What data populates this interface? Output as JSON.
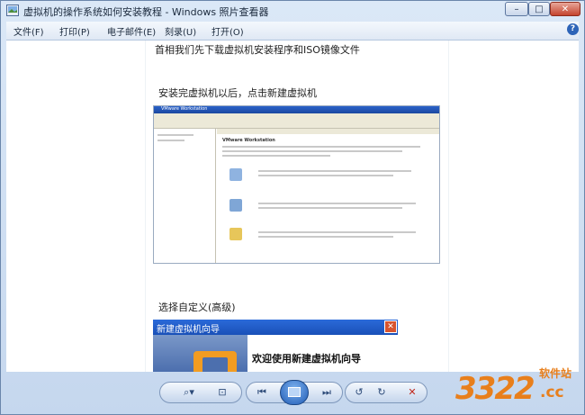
{
  "window": {
    "title": "虚拟机的操作系统如何安装教程 - Windows 照片查看器",
    "controls": {
      "minimize": "–",
      "maximize": "□",
      "close": "✕"
    }
  },
  "menubar": {
    "items": [
      "文件(F)",
      "打印(P)",
      "电子邮件(E)",
      "刻录(U)",
      "打开(O)"
    ],
    "help_glyph": "?"
  },
  "document": {
    "heading1": "首相我们先下载虚拟机安装程序和ISO镜像文件",
    "heading2": "安装完虚拟机以后，点击新建虚拟机",
    "embedded_screenshot": {
      "app_title": "VMware Workstation",
      "panel_title": "VMware Workstation"
    },
    "heading3": "选择自定义(高级)",
    "wizard": {
      "title": "新建虚拟机向导",
      "close_glyph": "✕",
      "welcome": "欢迎使用新建虚拟机向导"
    }
  },
  "toolbar": {
    "zoom": "⌕▾",
    "fit": "⊡",
    "prev": "⏮",
    "next": "⏭",
    "rotate_ccw": "↺",
    "rotate_cw": "↻",
    "delete": "✕"
  },
  "watermark": {
    "number": "3322",
    "domain": ".cc",
    "label": "软件站"
  },
  "colors": {
    "accent": "#1f5bb5",
    "watermark": "#e87f1c",
    "delete": "#c0281c"
  }
}
